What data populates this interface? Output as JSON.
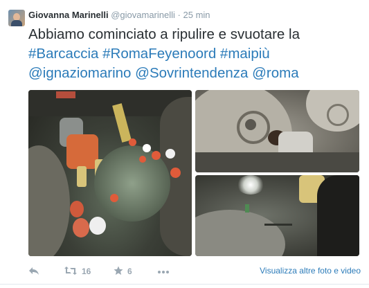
{
  "tweet": {
    "author_name": "Giovanna Marinelli",
    "author_handle": "@giovamarinelli",
    "separator": "·",
    "time": "25 min",
    "text_plain": "Abbiamo cominciato a ripulire e svuotare la",
    "hashtags": [
      "#Barcaccia",
      "#RomaFeyenoord",
      "#maipiù"
    ],
    "mentions": [
      "@ignaziomarino",
      "@Sovrintendenza",
      "@roma"
    ],
    "photos": [
      {
        "icon": "photo-fountain-cleaning"
      },
      {
        "icon": "photo-fountain-basin"
      },
      {
        "icon": "photo-fountain-water"
      }
    ]
  },
  "actions": {
    "retweet_count": "16",
    "favorite_count": "6",
    "view_more_label": "Visualizza altre foto e video"
  },
  "colors": {
    "link": "#2b7bb9",
    "text": "#292f33",
    "muted": "#8899a6"
  }
}
